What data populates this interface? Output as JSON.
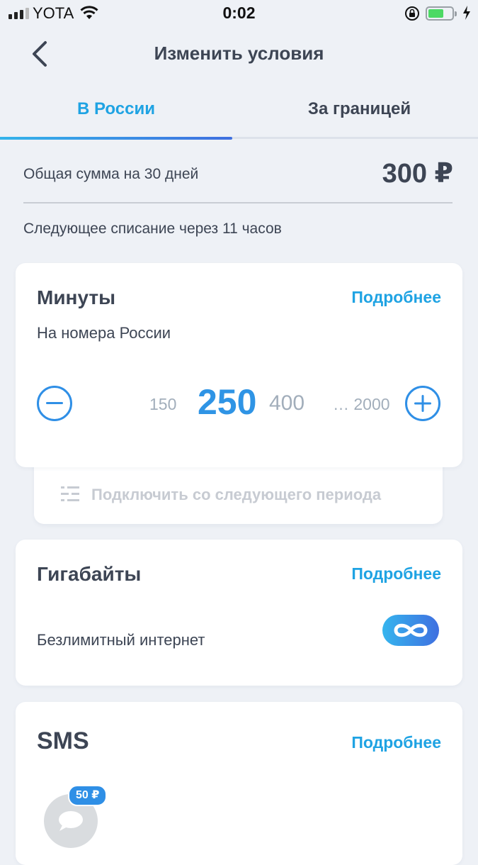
{
  "status_bar": {
    "carrier": "YOTA",
    "time": "0:02",
    "battery_level": 0.65
  },
  "header": {
    "title": "Изменить условия"
  },
  "tabs": [
    {
      "label": "В России",
      "active": true
    },
    {
      "label": "За границей",
      "active": false
    }
  ],
  "summary": {
    "total_label": "Общая сумма на 30 дней",
    "total_value": "300 ₽",
    "next_charge": "Следующее списание через 11 часов"
  },
  "minutes": {
    "title": "Минуты",
    "more": "Подробнее",
    "subtitle": "На номера России",
    "options": {
      "prev": "150",
      "selected": "250",
      "next": "400",
      "max": "… 2000"
    },
    "connect_next": "Подключить со следующего периода"
  },
  "gigabytes": {
    "title": "Гигабайты",
    "more": "Подробнее",
    "subtitle": "Безлимитный интернет"
  },
  "sms": {
    "title": "SMS",
    "more": "Подробнее",
    "price_badge": "50 ₽"
  },
  "colors": {
    "accent": "#1fa3e3",
    "accent_dark": "#2f8fe6",
    "text": "#3d4554",
    "muted": "#a2aebb",
    "background": "#eef1f6"
  },
  "icons": [
    "signal-icon",
    "wifi-icon",
    "rotation-lock-icon",
    "battery-icon",
    "charging-bolt-icon",
    "back-arrow-icon",
    "minus-icon",
    "plus-icon",
    "list-settings-icon",
    "infinity-icon",
    "sms-bubble-icon"
  ]
}
